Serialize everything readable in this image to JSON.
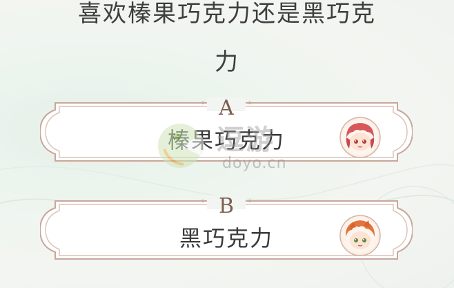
{
  "question": {
    "line1": "喜欢榛果巧克力还是黑巧克",
    "line2": "力"
  },
  "options": [
    {
      "letter": "A",
      "label": "榛果巧克力",
      "avatar_icon": "red-hair-chibi-avatar"
    },
    {
      "letter": "B",
      "label": "黑巧克力",
      "avatar_icon": "orange-hair-chibi-avatar"
    }
  ],
  "watermark": {
    "cn": "逗游",
    "en": "doyo.cn"
  },
  "colors": {
    "frame_outer": "#c9a79a",
    "frame_inner": "#d9bfb3",
    "option_fill": "#ffffff",
    "text_dark": "#3a3a3a",
    "letter": "#7a6050",
    "background": "#eef4ef"
  }
}
